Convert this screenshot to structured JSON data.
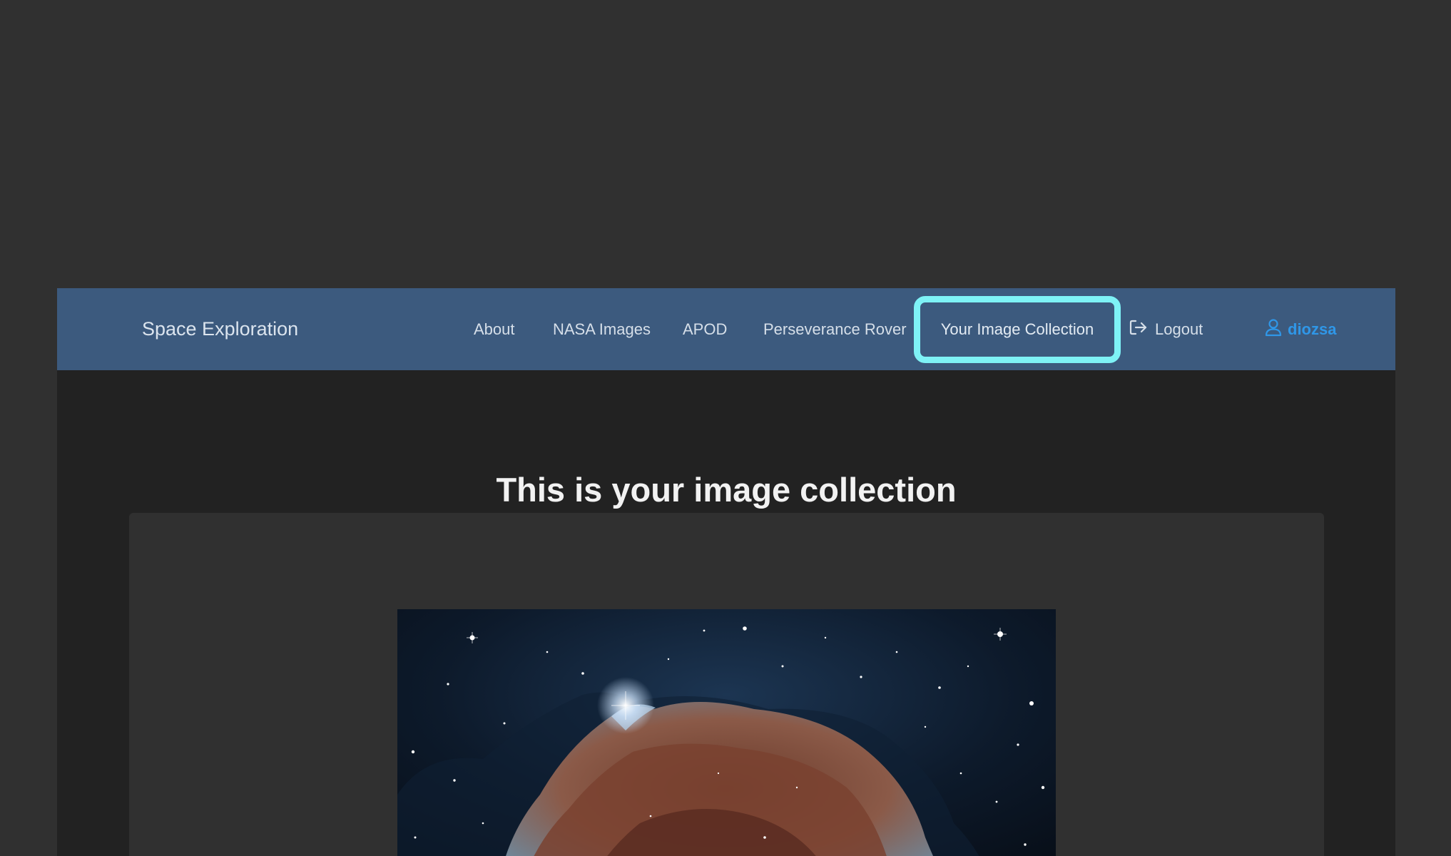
{
  "navbar": {
    "brand": "Space Exploration",
    "links": [
      {
        "label": "About"
      },
      {
        "label": "NASA Images"
      },
      {
        "label": "APOD"
      },
      {
        "label": "Perseverance Rover"
      },
      {
        "label": "Your Image Collection"
      }
    ],
    "logout_label": "Logout",
    "logout_icon": "sign-out-icon",
    "user_icon": "user-icon",
    "username": "diozsa"
  },
  "main": {
    "title": "This is your image collection"
  },
  "colors": {
    "navbar_bg": "#3c5a7e",
    "highlight_border": "#7ef2f6",
    "user_accent": "#2f97e8",
    "page_bg": "#222222",
    "card_bg": "#303030"
  }
}
